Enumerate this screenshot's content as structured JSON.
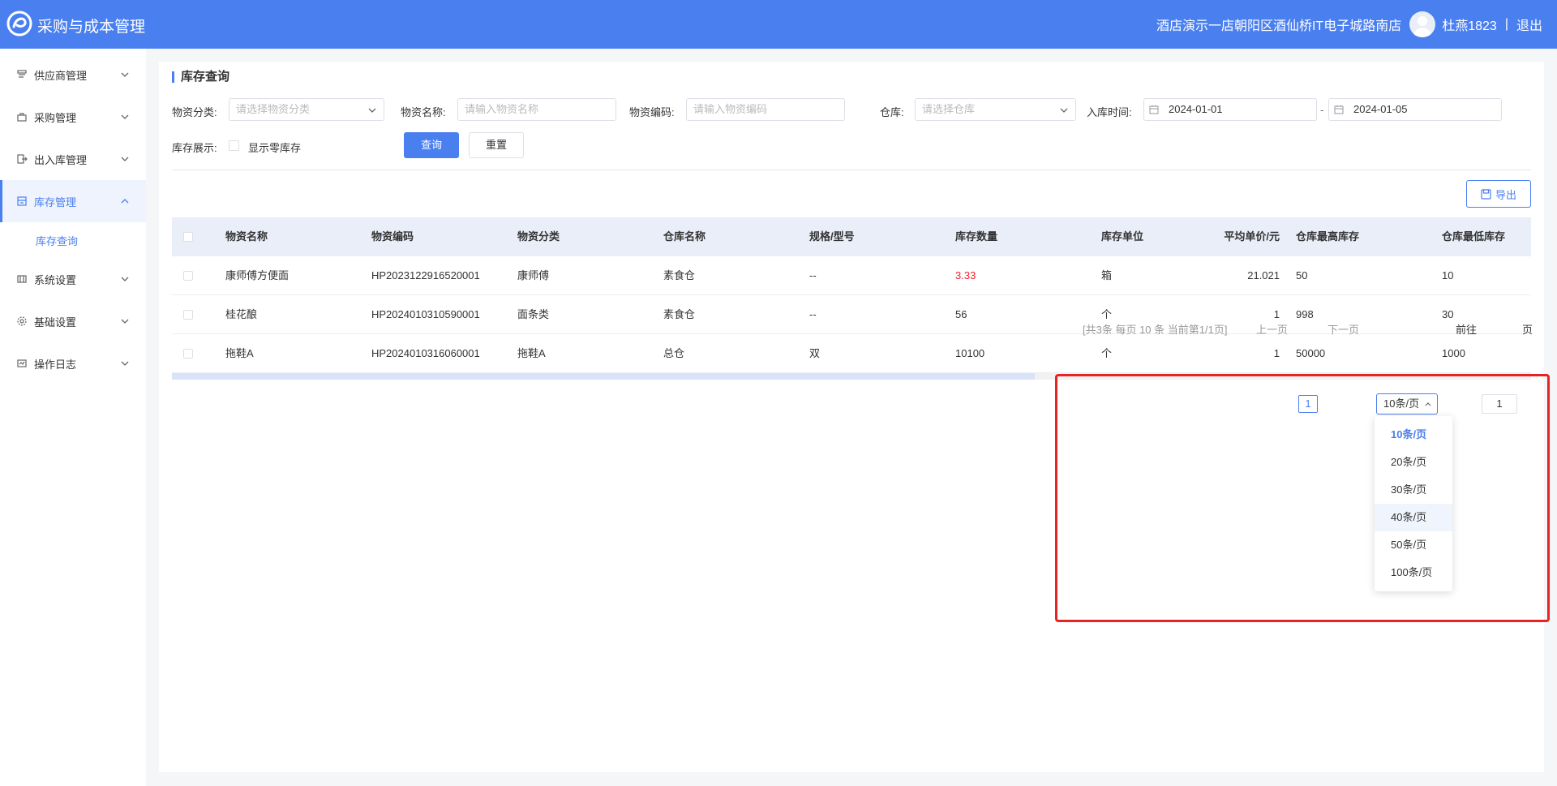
{
  "header": {
    "app_title": "采购与成本管理",
    "store": "酒店演示一店朝阳区酒仙桥IT电子城路南店",
    "user": "杜燕1823",
    "separator": "|",
    "logout": "退出",
    "accent_color": "#4a7ff0"
  },
  "sidebar": {
    "items": [
      {
        "label": "供应商管理",
        "icon": "supplier-icon"
      },
      {
        "label": "采购管理",
        "icon": "purchase-icon"
      },
      {
        "label": "出入库管理",
        "icon": "inout-icon"
      },
      {
        "label": "库存管理",
        "icon": "inventory-icon"
      },
      {
        "label": "系统设置",
        "icon": "settings-icon"
      },
      {
        "label": "基础设置",
        "icon": "gear-icon"
      },
      {
        "label": "操作日志",
        "icon": "log-icon"
      }
    ],
    "sub_item": "库存查询"
  },
  "page": {
    "title": "库存查询"
  },
  "filters": {
    "category_label": "物资分类:",
    "category_placeholder": "请选择物资分类",
    "name_label": "物资名称:",
    "name_placeholder": "请输入物资名称",
    "code_label": "物资编码:",
    "code_placeholder": "请输入物资编码",
    "warehouse_label": "仓库:",
    "warehouse_placeholder": "请选择仓库",
    "date_label": "入库时间:",
    "date_start": "2024-01-01",
    "date_sep": "-",
    "date_end": "2024-01-05",
    "display_label": "库存展示:",
    "zero_stock_label": "显示零库存",
    "query_button": "查询",
    "reset_button": "重置"
  },
  "toolbar": {
    "export_label": "导出"
  },
  "table": {
    "headers": [
      "物资名称",
      "物资编码",
      "物资分类",
      "仓库名称",
      "规格/型号",
      "库存数量",
      "库存单位",
      "平均单价/元",
      "仓库最高库存",
      "仓库最低库存"
    ],
    "rows": [
      {
        "name": "康师傅方便面",
        "code": "HP2023122916520001",
        "category": "康师傅",
        "warehouse": "素食仓",
        "spec": "--",
        "qty": "3.33",
        "unit": "箱",
        "price": "21.021",
        "max": "50",
        "min": "10"
      },
      {
        "name": "桂花酿",
        "code": "HP2024010310590001",
        "category": "面条类",
        "warehouse": "素食仓",
        "spec": "--",
        "qty": "56",
        "unit": "个",
        "price": "1",
        "max": "998",
        "min": "30"
      },
      {
        "name": "拖鞋A",
        "code": "HP2024010316060001",
        "category": "拖鞋A",
        "warehouse": "总仓",
        "spec": "双",
        "qty": "10100",
        "unit": "个",
        "price": "1",
        "max": "50000",
        "min": "1000"
      }
    ],
    "low_stock_color": "#f5222d"
  },
  "pagination": {
    "summary": "[共3条 每页 10 条 当前第1/1页]",
    "prev": "上一页",
    "current": "1",
    "next": "下一页",
    "page_size": "10条/页",
    "goto_label": "前往",
    "goto_value": "1",
    "page_suffix": "页",
    "options": [
      "10条/页",
      "20条/页",
      "30条/页",
      "40条/页",
      "50条/页",
      "100条/页"
    ]
  },
  "annotation": {
    "highlight_color": "#e82323"
  }
}
